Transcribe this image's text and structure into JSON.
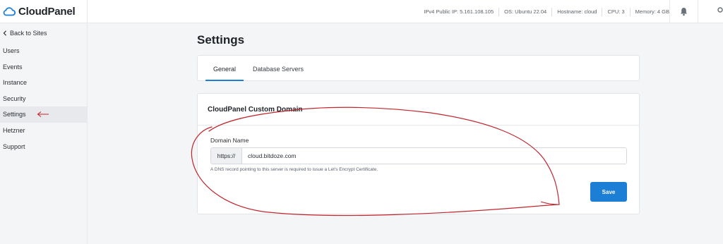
{
  "brand": {
    "name": "CloudPanel"
  },
  "header": {
    "ipv4": "IPv4 Public IP: 5.161.108.105",
    "os": "OS: Ubuntu 22.04",
    "hostname": "Hostname: cloud",
    "cpu": "CPU: 3",
    "memory": "Memory: 4 GB"
  },
  "sidebar": {
    "back_label": "Back to Sites",
    "items": [
      {
        "label": "Users"
      },
      {
        "label": "Events"
      },
      {
        "label": "Instance"
      },
      {
        "label": "Security"
      },
      {
        "label": "Settings",
        "active": true
      },
      {
        "label": "Hetzner"
      },
      {
        "label": "Support"
      }
    ]
  },
  "main": {
    "page_title": "Settings",
    "tabs": [
      {
        "label": "General",
        "active": true
      },
      {
        "label": "Database Servers"
      }
    ],
    "section_title": "CloudPanel Custom Domain",
    "domain_field": {
      "label": "Domain Name",
      "prefix": "https://",
      "value": "cloud.bitdoze.com",
      "help": "A DNS record pointing to this server is required to issue a Let's Encrypt Certificate."
    },
    "save_label": "Save"
  },
  "colors": {
    "accent": "#1d7ed6",
    "annotation": "#c0262d",
    "sidebar_active": "#e7e9ec"
  },
  "icons": [
    "cloud-logo-icon",
    "chevron-left-icon",
    "bell-icon",
    "user-icon",
    "arrow-annotation-icon"
  ]
}
